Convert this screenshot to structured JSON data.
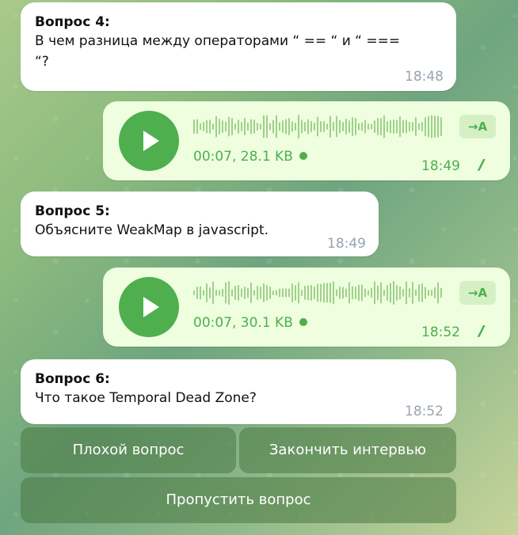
{
  "messages": [
    {
      "title": "Вопрос 4:",
      "text_line1": "В чем разница между операторами “ == “ и “ ===",
      "text_line2": "“?",
      "time": "18:48"
    },
    {
      "voice_info": "00:07, 28.1 KB",
      "transcribe": "→A",
      "time": "18:49",
      "checks": "//"
    },
    {
      "title": "Вопрос 5:",
      "text_line1": "Объясните WeakMap в javascript.",
      "time": "18:49"
    },
    {
      "voice_info": "00:07, 30.1 KB",
      "transcribe": "→A",
      "time": "18:52",
      "checks": "//"
    },
    {
      "title": "Вопрос 6:",
      "text_line1": "Что такое Temporal Dead Zone?",
      "time": "18:52"
    }
  ],
  "keyboard": {
    "bad_question": "Плохой вопрос",
    "finish_interview": "Закончить интервью",
    "skip_question": "Пропустить вопрос"
  },
  "colors": {
    "accent": "#4fae4e",
    "outgoing_bubble": "#eefedf",
    "incoming_bubble": "#ffffff",
    "time_gray": "#9aa4ad"
  }
}
